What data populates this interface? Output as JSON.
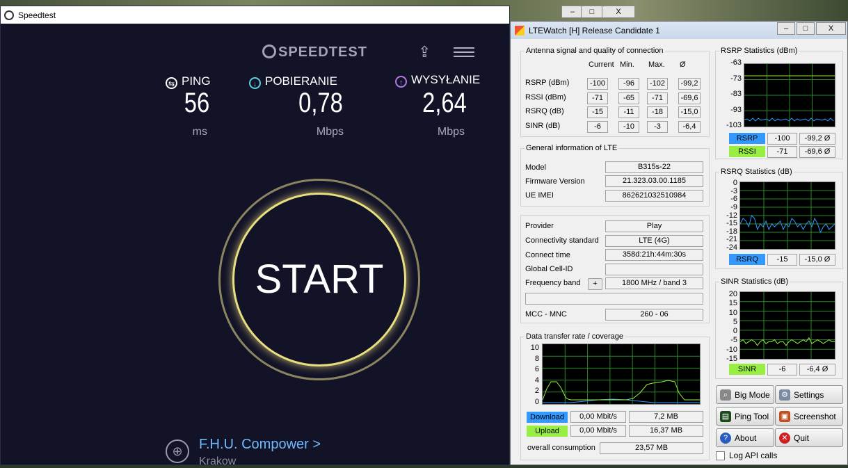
{
  "speedtest": {
    "window_title": "Speedtest",
    "brand": "SPEEDTEST",
    "ping": {
      "label": "PING",
      "value": "56",
      "unit": "ms"
    },
    "download": {
      "label": "POBIERANIE",
      "value": "0,78",
      "unit": "Mbps"
    },
    "upload": {
      "label": "WYSYŁANIE",
      "value": "2,64",
      "unit": "Mbps"
    },
    "start_label": "START",
    "isp": "F.H.U. Compower",
    "isp_chevron": ">",
    "city": "Krakow",
    "colors": {
      "ping_icon": "#ffffff",
      "download_icon": "#5ad1e0",
      "upload_icon": "#b07ae8",
      "ring": "#e8e080"
    }
  },
  "lte": {
    "window_title": "LTEWatch [H]   Release Candidate 1",
    "antenna": {
      "title": "Antenna signal and quality of connection",
      "headers": [
        "Current",
        "Min.",
        "Max.",
        "Ø"
      ],
      "rows": [
        {
          "label": "RSRP (dBm)",
          "values": [
            "-100",
            "-96",
            "-102",
            "-99,2"
          ]
        },
        {
          "label": "RSSI (dBm)",
          "values": [
            "-71",
            "-65",
            "-71",
            "-69,6"
          ]
        },
        {
          "label": "RSRQ (dB)",
          "values": [
            "-15",
            "-11",
            "-18",
            "-15,0"
          ]
        },
        {
          "label": "SINR (dB)",
          "values": [
            "-6",
            "-10",
            "-3",
            "-6,4"
          ]
        }
      ]
    },
    "general": {
      "title": "General information of LTE",
      "model_label": "Model",
      "model": "B315s-22",
      "fw_label": "Firmware Version",
      "fw": "21.323.03.00.1185",
      "imei_label": "UE IMEI",
      "imei": "862621032510984"
    },
    "provider": {
      "provider_label": "Provider",
      "provider": "Play",
      "std_label": "Connectivity standard",
      "std": "LTE (4G)",
      "time_label": "Connect time",
      "time": "358d:21h:44m:30s",
      "cell_label": "Global Cell-ID",
      "cell": "",
      "band_label": "Frequency band",
      "band_btn": "+",
      "band": "1800 MHz / band 3",
      "mcc_label": "MCC - MNC",
      "mcc": "260 - 06"
    },
    "transfer": {
      "title": "Data transfer rate / coverage",
      "yticks": [
        "10",
        "8",
        "6",
        "4",
        "2",
        "0"
      ],
      "download_label": "Download",
      "download_rate": "0,00 Mbit/s",
      "download_total": "7,2 MB",
      "upload_label": "Upload",
      "upload_rate": "0,00 Mbit/s",
      "upload_total": "16,37 MB",
      "overall_label": "overall consumption",
      "overall": "23,57 MB"
    },
    "rsrp_stats": {
      "title": "RSRP Statistics (dBm)",
      "yticks": [
        "-63",
        "-73",
        "-83",
        "-93",
        "-103"
      ],
      "rsrp_tag": "RSRP",
      "rsrp_cur": "-100",
      "rsrp_avg": "-99,2 Ø",
      "rssi_tag": "RSSI",
      "rssi_cur": "-71",
      "rssi_avg": "-69,6 Ø"
    },
    "rsrq_stats": {
      "title": "RSRQ Statistics (dB)",
      "yticks": [
        "0",
        "-3",
        "-6",
        "-9",
        "-12",
        "-15",
        "-18",
        "-21",
        "-24"
      ],
      "tag": "RSRQ",
      "cur": "-15",
      "avg": "-15,0 Ø"
    },
    "sinr_stats": {
      "title": "SINR Statistics (dB)",
      "yticks": [
        "20",
        "15",
        "10",
        "5",
        "0",
        "-5",
        "-10",
        "-15"
      ],
      "tag": "SINR",
      "cur": "-6",
      "avg": "-6,4 Ø"
    },
    "buttons": {
      "big_mode": "Big Mode",
      "settings": "Settings",
      "ping_tool": "Ping Tool",
      "screenshot": "Screenshot",
      "about": "About",
      "quit": "Quit"
    },
    "log_api": "Log API calls",
    "colors": {
      "download": "#3399ff",
      "upload": "#99ee44",
      "rsrp": "#3399ff",
      "rssi": "#99ee44",
      "grid": "#2a8a2a"
    }
  },
  "window_controls": {
    "min": "–",
    "max": "□",
    "close": "X"
  }
}
